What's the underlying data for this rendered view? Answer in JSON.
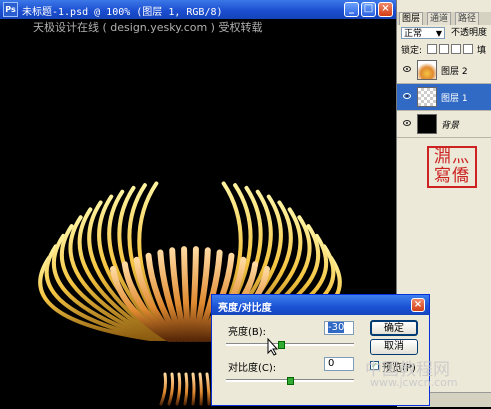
{
  "document": {
    "title": "未标题-1.psd @ 100% (图层 1, RGB/8)",
    "watermark": "天极设计在线 ( design.yesky.com ) 受权转载"
  },
  "layers_panel": {
    "tabs": [
      "图层",
      "通道",
      "路径"
    ],
    "blend_mode": "正常",
    "opacity_label": "不透明度",
    "lock_label": "锁定:",
    "fill_label": "填",
    "layers": [
      {
        "name": "图层 2",
        "visible": true,
        "selected": false,
        "thumb": "flame"
      },
      {
        "name": "图层 1",
        "visible": true,
        "selected": true,
        "thumb": "checker"
      },
      {
        "name": "背景",
        "visible": true,
        "selected": false,
        "thumb": "black"
      }
    ],
    "seal_text": "淵灬\n寫僑"
  },
  "dialog": {
    "title": "亮度/对比度",
    "brightness_label": "亮度(B):",
    "brightness_value": "-30",
    "brightness_fraction": 0.43,
    "contrast_label": "对比度(C):",
    "contrast_value": "0",
    "contrast_fraction": 0.5,
    "ok_label": "确定",
    "cancel_label": "取消",
    "preview_label": "预览(P)",
    "preview_checked": true
  },
  "overlay": {
    "site_name": "中国教程网",
    "site_url": "www.jcwcn.com"
  },
  "colors": {
    "xp_title_blue": "#1a4ccf",
    "selection_blue": "#316ac5",
    "flame_gold": "#f5c542",
    "flame_orange": "#e08a30"
  }
}
